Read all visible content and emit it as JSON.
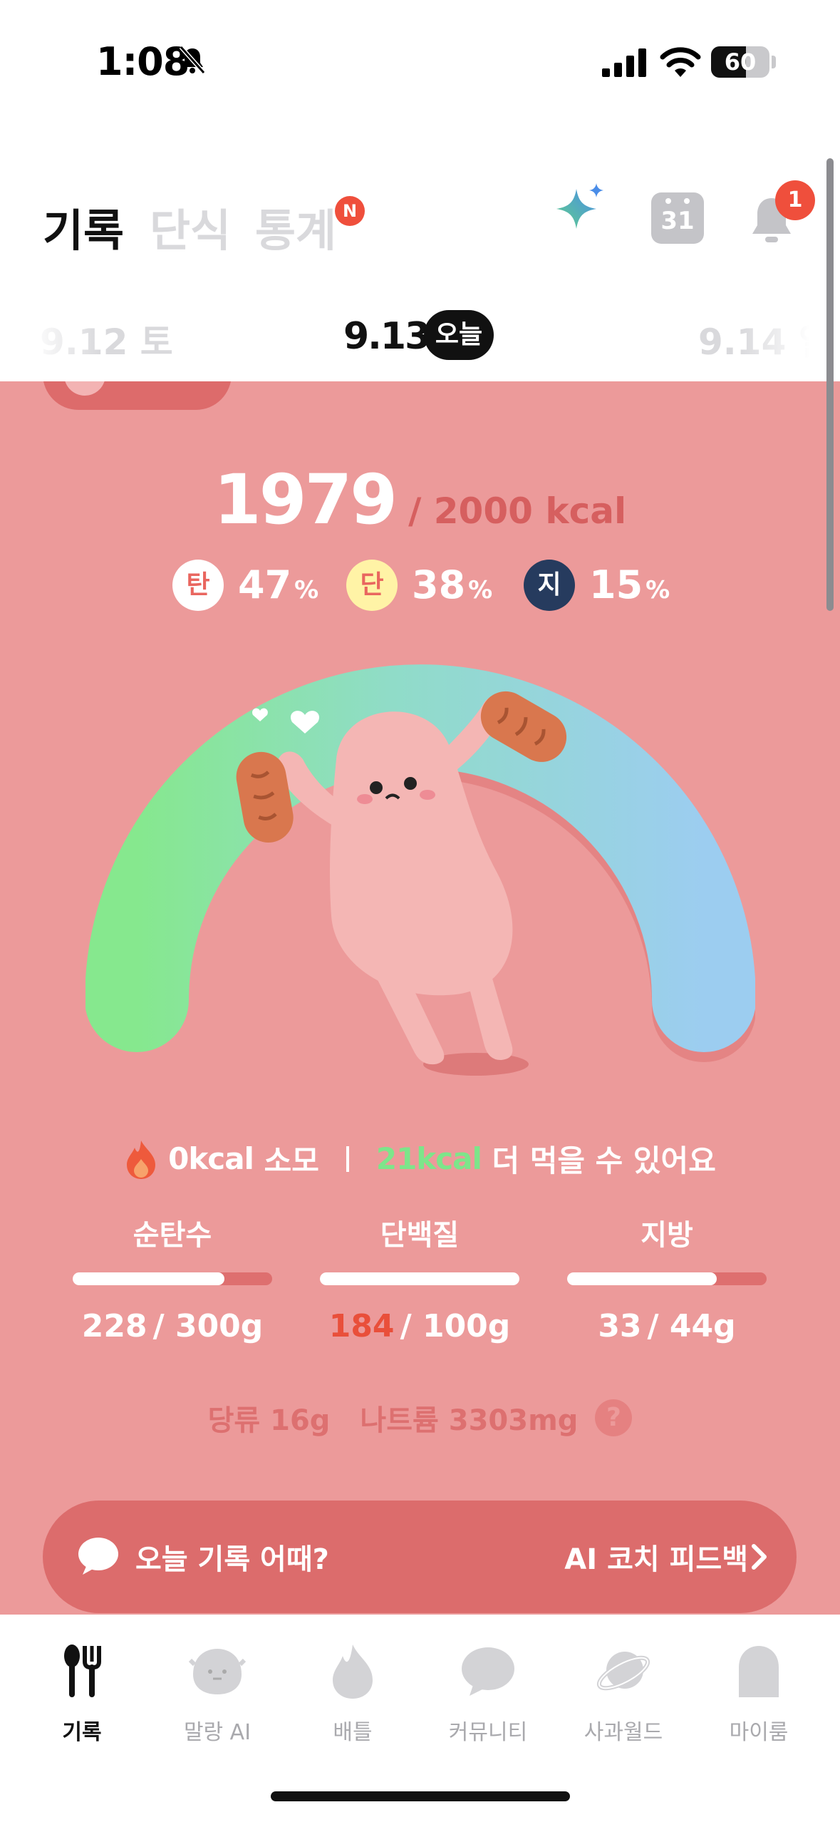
{
  "status_bar": {
    "time": "1:08",
    "battery": "60",
    "battery_level": 0.6
  },
  "header": {
    "tabs": [
      {
        "label": "기록",
        "active": true
      },
      {
        "label": "단식",
        "active": false
      },
      {
        "label": "통계",
        "active": false,
        "badge": "N"
      }
    ],
    "calendar_day": "31",
    "notification_count": "1"
  },
  "date_nav": {
    "prev": "9.12 토",
    "current": "9.13",
    "today_label": "오늘",
    "next": "9.14 일"
  },
  "summary": {
    "kcal_eaten": "1979",
    "kcal_goal_text": "/ 2000 kcal",
    "macro_ratios": [
      {
        "label": "탄",
        "percent": "47",
        "unit": "%",
        "color": "#ffffff",
        "text_color": "#e9665f"
      },
      {
        "label": "단",
        "percent": "38",
        "unit": "%",
        "color": "#fff3a6",
        "text_color": "#e9665f"
      },
      {
        "label": "지",
        "percent": "15",
        "unit": "%",
        "color": "#263b5e",
        "text_color": "#ffffff"
      }
    ],
    "gauge": {
      "progress": 0.99,
      "start_color": "#86e88e",
      "end_color": "#9ccdf0"
    },
    "burned": "0kcal",
    "burned_suffix": "소모",
    "remaining": "21kcal",
    "remaining_suffix": "더 먹을 수 있어요"
  },
  "nutrients": [
    {
      "label": "순탄수",
      "current": "228",
      "goal": "/ 300g",
      "fraction": 0.76,
      "over": false
    },
    {
      "label": "단백질",
      "current": "184",
      "goal": "/ 100g",
      "fraction": 1.0,
      "over": true
    },
    {
      "label": "지방",
      "current": "33",
      "goal": "/ 44g",
      "fraction": 0.75,
      "over": false
    }
  ],
  "extras": {
    "sugar": "당류 16g",
    "sodium": "나트륨 3303mg",
    "help": "?"
  },
  "coach": {
    "question": "오늘 기록 어때?",
    "link": "AI 코치 피드백"
  },
  "bottom_nav": [
    {
      "label": "기록",
      "icon": "fork-knife-icon",
      "active": true
    },
    {
      "label": "말랑 AI",
      "icon": "blob-face-icon",
      "active": false
    },
    {
      "label": "배틀",
      "icon": "flame-icon",
      "active": false
    },
    {
      "label": "커뮤니티",
      "icon": "chat-bubble-icon",
      "active": false
    },
    {
      "label": "사과월드",
      "icon": "planet-icon",
      "active": false
    },
    {
      "label": "마이룸",
      "icon": "ghost-icon",
      "active": false
    }
  ]
}
